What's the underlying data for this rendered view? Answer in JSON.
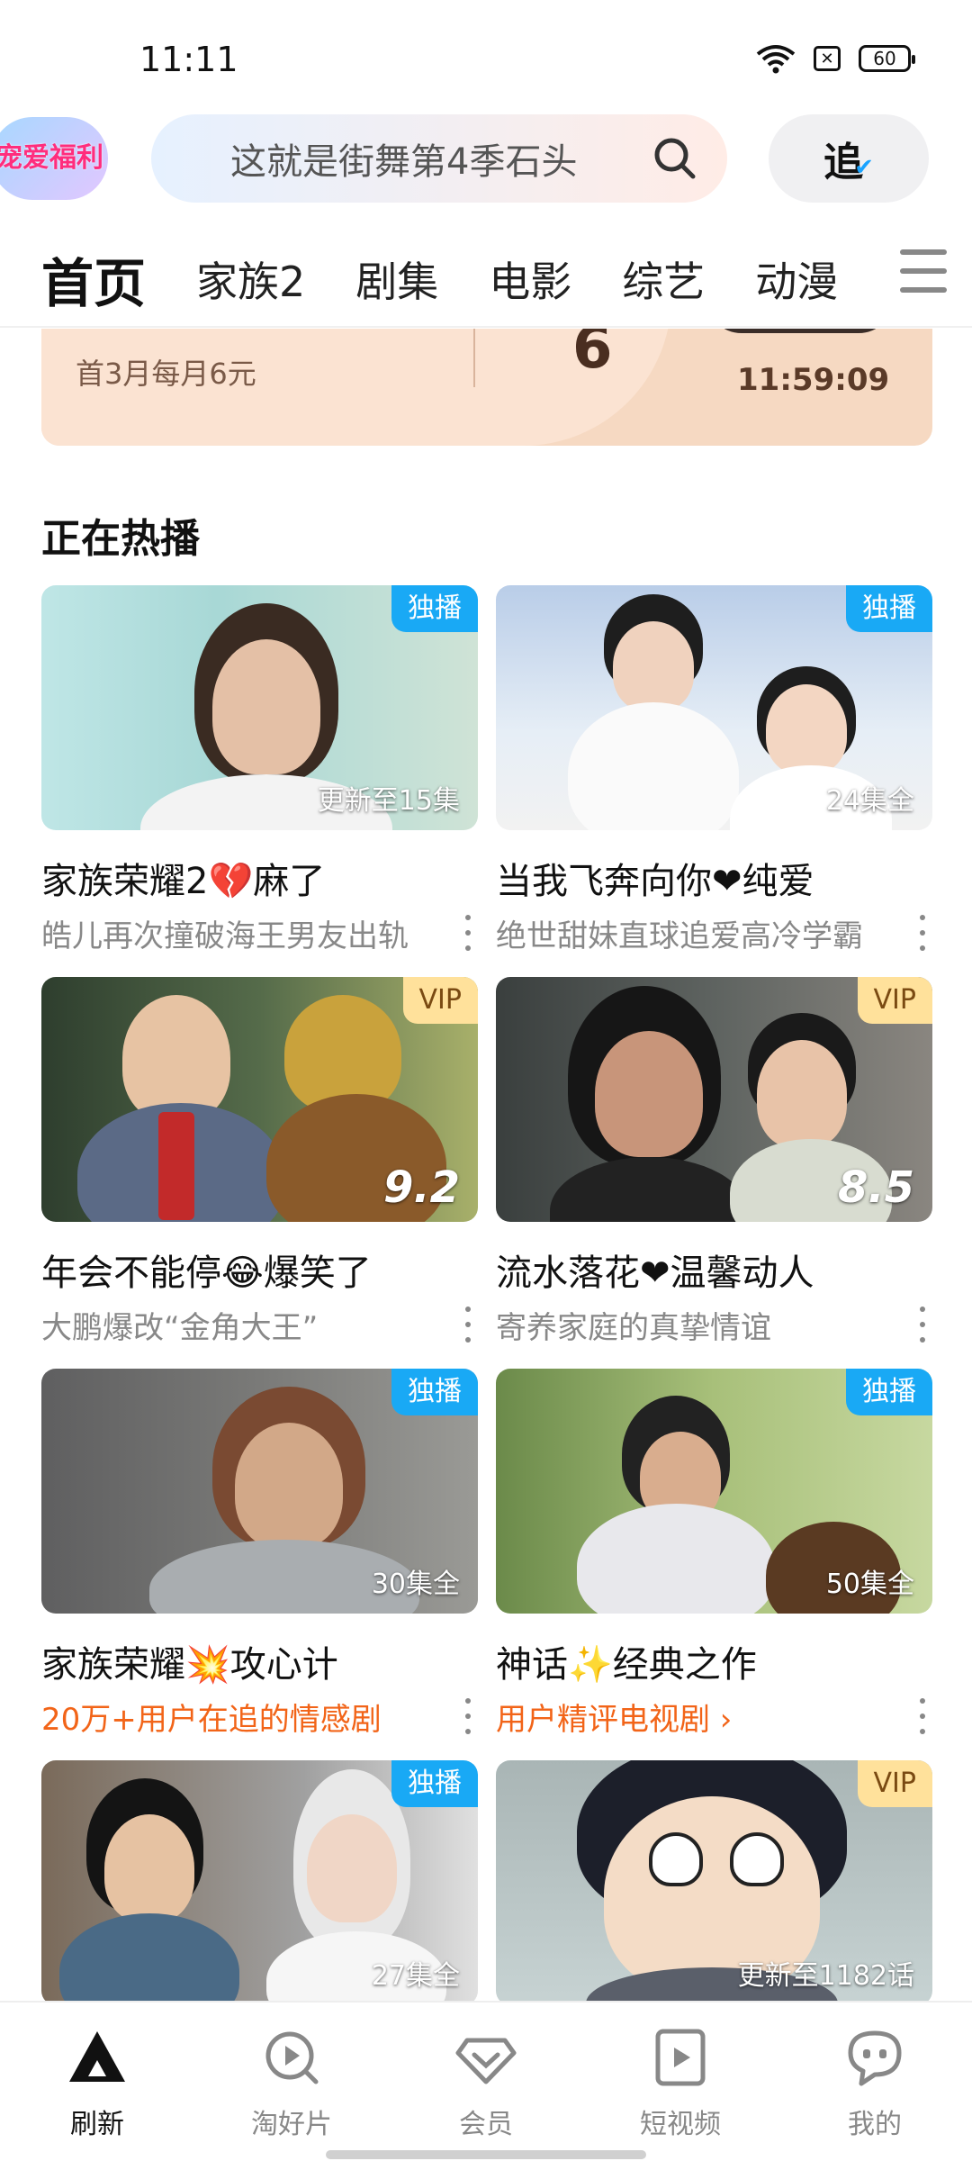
{
  "status_bar": {
    "time": "11:11",
    "battery": "60"
  },
  "header": {
    "promo_badge": "宠爱福利",
    "search_placeholder": "这就是街舞第4季石头",
    "follow_label": "追"
  },
  "tabs": [
    {
      "label": "首页",
      "active": true
    },
    {
      "label": "家族2"
    },
    {
      "label": "剧集"
    },
    {
      "label": "电影"
    },
    {
      "label": "综艺"
    },
    {
      "label": "动漫"
    }
  ],
  "banner": {
    "price_sub": "首3月每月6元",
    "price_big": "6",
    "countdown": "11:59:09"
  },
  "section": {
    "title": "正在热播"
  },
  "cards": [
    {
      "badge": "独播",
      "badge_type": "exclusive",
      "overlay": "更新至15集",
      "title": "家族荣耀2💔麻了",
      "subtitle": "皓儿再次撞破海王男友出轨",
      "subtitle_style": "gray"
    },
    {
      "badge": "独播",
      "badge_type": "exclusive",
      "overlay": "24集全",
      "title": "当我飞奔向你❤纯爱",
      "subtitle": "绝世甜妹直球追爱高冷学霸",
      "subtitle_style": "gray"
    },
    {
      "badge": "VIP",
      "badge_type": "vip",
      "score": "9.2",
      "title": "年会不能停😂爆笑了",
      "subtitle": "大鹏爆改“金角大王”",
      "subtitle_style": "gray"
    },
    {
      "badge": "VIP",
      "badge_type": "vip",
      "score": "8.5",
      "title": "流水落花❤温馨动人",
      "subtitle": "寄养家庭的真挚情谊",
      "subtitle_style": "gray"
    },
    {
      "badge": "独播",
      "badge_type": "exclusive",
      "overlay": "30集全",
      "title": "家族荣耀💥攻心计",
      "subtitle": "20万+用户在追的情感剧",
      "subtitle_style": "orange"
    },
    {
      "badge": "独播",
      "badge_type": "exclusive",
      "overlay": "50集全",
      "title": "神话✨经典之作",
      "subtitle": "用户精评电视剧 ›",
      "subtitle_style": "orange"
    },
    {
      "badge": "独播",
      "badge_type": "exclusive",
      "overlay": "27集全",
      "title": "",
      "subtitle": "",
      "subtitle_style": "gray"
    },
    {
      "badge": "VIP",
      "badge_type": "vip",
      "overlay": "更新至1182话",
      "title": "",
      "subtitle": "",
      "subtitle_style": "gray"
    }
  ],
  "bottom_nav": [
    {
      "label": "刷新",
      "icon": "refresh-triangle-icon",
      "active": true
    },
    {
      "label": "淘好片",
      "icon": "discover-play-icon"
    },
    {
      "label": "会员",
      "icon": "vip-diamond-icon"
    },
    {
      "label": "短视频",
      "icon": "short-video-icon"
    },
    {
      "label": "我的",
      "icon": "profile-chat-icon"
    }
  ],
  "colors": {
    "accent_blue": "#19a9f5",
    "vip_gold": "#ffe19b",
    "orange_text": "#f26418"
  }
}
